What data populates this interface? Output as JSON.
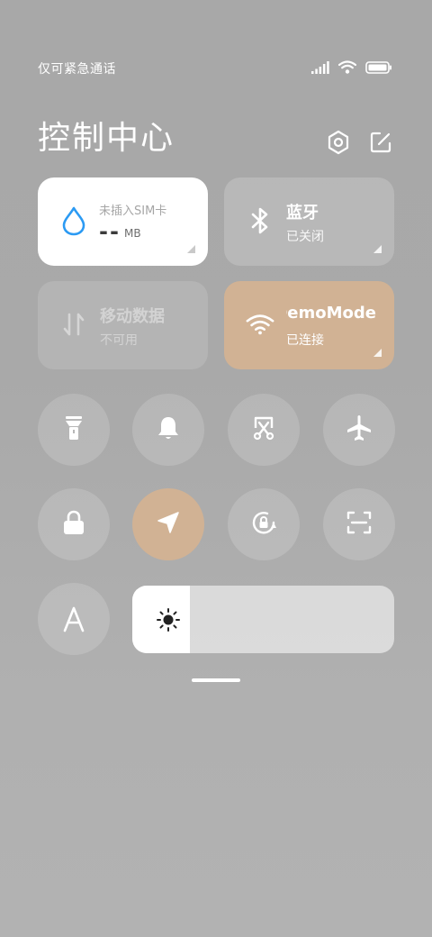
{
  "status_bar": {
    "carrier_text": "仅可紧急通话",
    "icons": [
      "signal-icon",
      "wifi-icon",
      "battery-icon"
    ]
  },
  "header": {
    "title": "控制中心",
    "buttons": [
      "settings-icon",
      "edit-icon"
    ]
  },
  "cards": {
    "data": {
      "label": "未插入SIM卡",
      "value": "--",
      "unit": "MB",
      "icon": "water-drop-icon"
    },
    "bluetooth": {
      "title": "蓝牙",
      "subtitle": "已关闭",
      "icon": "bluetooth-icon"
    },
    "mobile_data": {
      "title": "移动数据",
      "subtitle": "不可用",
      "icon": "mobile-data-icon"
    },
    "wifi": {
      "title": "DemoMode",
      "subtitle": "已连接",
      "icon": "wifi-icon"
    }
  },
  "toggles": [
    {
      "name": "flashlight",
      "icon": "flashlight-icon",
      "active": false
    },
    {
      "name": "ringer",
      "icon": "bell-icon",
      "active": false
    },
    {
      "name": "screenshot",
      "icon": "scissors-icon",
      "active": false
    },
    {
      "name": "airplane-mode",
      "icon": "airplane-icon",
      "active": false
    },
    {
      "name": "lock-screen",
      "icon": "lock-icon",
      "active": false
    },
    {
      "name": "location",
      "icon": "location-arrow-icon",
      "active": true
    },
    {
      "name": "rotation-lock",
      "icon": "rotation-lock-icon",
      "active": false
    },
    {
      "name": "scanner",
      "icon": "scan-icon",
      "active": false
    },
    {
      "name": "auto-brightness",
      "icon": "letter-a-icon",
      "label": "A",
      "active": false
    }
  ],
  "brightness": {
    "level": 0.22,
    "icon": "sun-icon"
  },
  "colors": {
    "accent": "#d1b294",
    "background": "#a9a9a9",
    "card_white": "#ffffff",
    "drop_blue": "#2b9af3"
  }
}
